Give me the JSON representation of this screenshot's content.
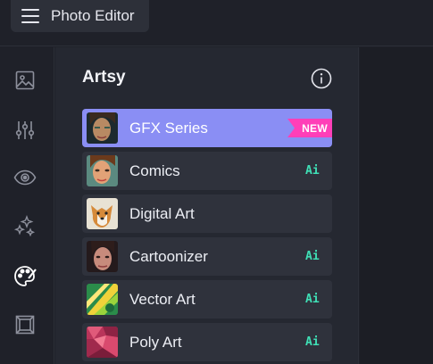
{
  "app": {
    "title": "Photo Editor",
    "menu_icon": "hamburger-menu-icon"
  },
  "rail": {
    "items": [
      {
        "icon": "image-icon",
        "active": false
      },
      {
        "icon": "adjust-sliders-icon",
        "active": false
      },
      {
        "icon": "eye-icon",
        "active": false
      },
      {
        "icon": "sparkles-icon",
        "active": false
      },
      {
        "icon": "palette-icon",
        "active": true
      },
      {
        "icon": "frame-icon",
        "active": false
      }
    ]
  },
  "panel": {
    "title": "Artsy",
    "info_icon": "info-icon",
    "items": [
      {
        "label": "GFX Series",
        "badge": "NEW",
        "active": true
      },
      {
        "label": "Comics",
        "badge": "Ai",
        "active": false
      },
      {
        "label": "Digital Art",
        "badge": "",
        "active": false
      },
      {
        "label": "Cartoonizer",
        "badge": "Ai",
        "active": false
      },
      {
        "label": "Vector Art",
        "badge": "Ai",
        "active": false
      },
      {
        "label": "Poly Art",
        "badge": "Ai",
        "active": false
      }
    ]
  },
  "colors": {
    "accent": "#8a8ef4",
    "new_badge": "#ff3fb8",
    "ai_badge": "#3fe0b6",
    "background": "#1f2129",
    "panel": "#252831"
  }
}
